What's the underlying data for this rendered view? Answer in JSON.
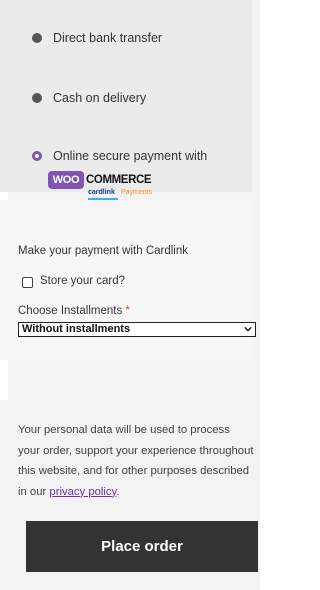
{
  "payment_methods": [
    {
      "label": "Direct bank transfer",
      "selected": false
    },
    {
      "label": "Cash on delivery",
      "selected": false
    },
    {
      "label": "Online secure payment with",
      "selected": true
    }
  ],
  "logo": {
    "woo": "WOO",
    "commerce": "COMMERCE",
    "cardlink": "cardlink",
    "payments": "Payments"
  },
  "cardlink_form": {
    "intro": "Make your payment with Cardlink",
    "store_card_label": "Store your card?",
    "installments_label": "Choose Installments",
    "required_mark": "*",
    "installments_selected": "Without installments"
  },
  "privacy": {
    "text": "Your personal data will be used to process your order, support your experience throughout this website, and for other purposes described in our ",
    "link_label": "privacy policy",
    "end": "."
  },
  "place_order_label": "Place order",
  "colors": {
    "accent": "#7f54b3",
    "button": "#333333",
    "required": "#e2401c"
  }
}
